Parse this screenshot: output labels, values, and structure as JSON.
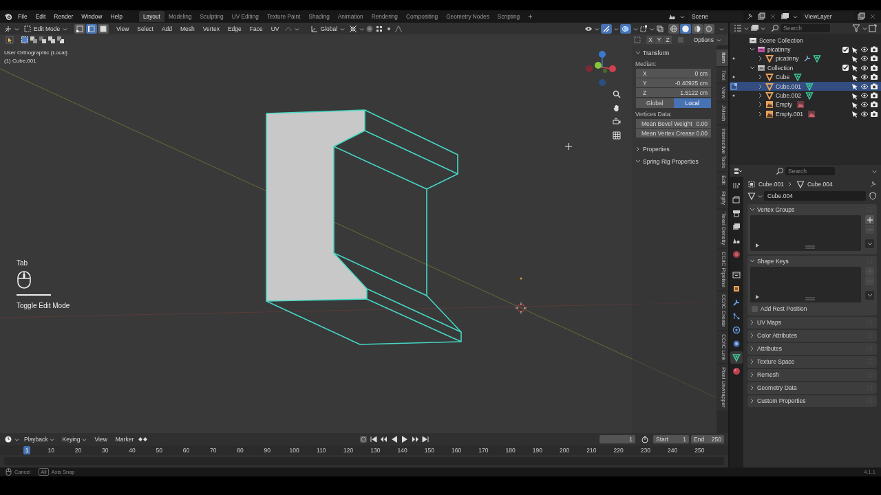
{
  "menu_bar": {
    "menus": [
      "File",
      "Edit",
      "Render",
      "Window",
      "Help"
    ],
    "workspaces": [
      {
        "label": "Layout",
        "selected": true
      },
      {
        "label": "Modeling",
        "selected": false
      },
      {
        "label": "Sculpting",
        "selected": false
      },
      {
        "label": "UV Editing",
        "selected": false
      },
      {
        "label": "Texture Paint",
        "selected": false
      },
      {
        "label": "Shading",
        "selected": false
      },
      {
        "label": "Animation",
        "selected": false
      },
      {
        "label": "Rendering",
        "selected": false
      },
      {
        "label": "Compositing",
        "selected": false
      },
      {
        "label": "Geometry Nodes",
        "selected": false
      },
      {
        "label": "Scripting",
        "selected": false
      }
    ],
    "add_workspace": "+",
    "scene": "Scene",
    "view_layer": "ViewLayer"
  },
  "viewport_header": {
    "mode": "Edit Mode",
    "select_modes": [
      {
        "kind": "vertex",
        "selected": false
      },
      {
        "kind": "edge",
        "selected": true
      },
      {
        "kind": "face",
        "selected": false
      }
    ],
    "menus": [
      "View",
      "Select",
      "Add",
      "Mesh",
      "Vertex",
      "Edge",
      "Face",
      "UV"
    ],
    "orientation": "Global",
    "shading": [
      {
        "kind": "wireframe",
        "selected": false
      },
      {
        "kind": "solid",
        "selected": true
      },
      {
        "kind": "material",
        "selected": false
      },
      {
        "kind": "rendered",
        "selected": false
      }
    ],
    "mirror_axes": [
      "X",
      "Y",
      "Z"
    ],
    "options": "Options"
  },
  "viewport": {
    "view_name": "User Orthographic (Local)",
    "object_name": "(1) Cube.001",
    "key_hint": {
      "key": "Tab",
      "action": "Toggle Edit Mode"
    }
  },
  "sidebar": {
    "section": "Transform",
    "median_label": "Median:",
    "fields": [
      {
        "label": "X",
        "value": "0 cm"
      },
      {
        "label": "Y",
        "value": "-0.40925 cm"
      },
      {
        "label": "Z",
        "value": "1.5122 cm"
      }
    ],
    "space": [
      {
        "label": "Global",
        "selected": false
      },
      {
        "label": "Local",
        "selected": true
      }
    ],
    "vertices_label": "Vertices Data:",
    "vertex_fields": [
      {
        "label": "Mean Bevel Weight",
        "value": "0.00"
      },
      {
        "label": "Mean Vertex Crease",
        "value": "0.00"
      }
    ],
    "panels": [
      {
        "label": "Properties",
        "expanded": false
      },
      {
        "label": "Spring Rig Properties",
        "expanded": true
      }
    ],
    "tabs": [
      {
        "label": "Item",
        "selected": true
      },
      {
        "label": "Tool",
        "selected": false
      },
      {
        "label": "View",
        "selected": false
      },
      {
        "label": "JMesh",
        "selected": false
      },
      {
        "label": "Interactive Tools",
        "selected": false
      },
      {
        "label": "Edit",
        "selected": false
      },
      {
        "label": "Rigify",
        "selected": false
      },
      {
        "label": "Texel Density",
        "selected": false
      },
      {
        "label": "CC/iC Pipeline",
        "selected": false
      },
      {
        "label": "CC/iC Create",
        "selected": false
      },
      {
        "label": "CC/iC Link",
        "selected": false
      },
      {
        "label": "Pixel Unwrapper",
        "selected": false
      }
    ]
  },
  "outliner": {
    "search_placeholder": "Search",
    "items": [
      {
        "label": "Scene Collection",
        "kind": "scene",
        "selected": false,
        "children": [
          {
            "label": "picatinny",
            "kind": "collection",
            "color": "#b84fa0",
            "expanded": true,
            "checked": true,
            "selected": false,
            "children": [
              {
                "label": "picatinny",
                "kind": "mesh",
                "expanded": false,
                "modifier": true,
                "selected": false
              }
            ]
          },
          {
            "label": "Collection",
            "kind": "collection",
            "color": "#9a9a9a",
            "expanded": true,
            "checked": true,
            "selected": false,
            "children": [
              {
                "label": "Cube",
                "kind": "mesh",
                "expanded": false,
                "modifier": false,
                "selected": false
              },
              {
                "label": "Cube.001",
                "kind": "mesh",
                "expanded": false,
                "modifier": false,
                "selected": true
              },
              {
                "label": "Cube.002",
                "kind": "mesh",
                "expanded": false,
                "modifier": false,
                "selected": false
              },
              {
                "label": "Empty",
                "kind": "empty",
                "expanded": false,
                "selected": false
              },
              {
                "label": "Empty.001",
                "kind": "empty",
                "expanded": false,
                "selected": false
              }
            ]
          }
        ]
      }
    ]
  },
  "properties": {
    "search_placeholder": "Search",
    "tabs": [
      {
        "kind": "tool",
        "selected": false
      },
      {
        "kind": "render",
        "selected": false
      },
      {
        "kind": "output",
        "selected": false
      },
      {
        "kind": "view_layer",
        "selected": false
      },
      {
        "kind": "scene",
        "selected": false
      },
      {
        "kind": "world",
        "selected": false
      },
      {
        "kind": "collection",
        "selected": false
      },
      {
        "kind": "object",
        "selected": false
      },
      {
        "kind": "modifiers",
        "selected": false
      },
      {
        "kind": "particles",
        "selected": false
      },
      {
        "kind": "physics",
        "selected": false
      },
      {
        "kind": "constraints",
        "selected": false
      },
      {
        "kind": "data",
        "selected": true
      },
      {
        "kind": "material",
        "selected": false
      }
    ],
    "breadcrumb": [
      "Cube.001",
      "Cube.004"
    ],
    "data_name": "Cube.004",
    "panels": [
      {
        "label": "Vertex Groups",
        "kind": "list",
        "expanded": true
      },
      {
        "label": "Shape Keys",
        "kind": "list",
        "expanded": true,
        "checkbox": {
          "label": "Add Rest Position",
          "checked": false
        }
      },
      {
        "label": "UV Maps",
        "kind": "plain",
        "expanded": false
      },
      {
        "label": "Color Attributes",
        "kind": "plain",
        "expanded": false
      },
      {
        "label": "Attributes",
        "kind": "plain",
        "expanded": false
      },
      {
        "label": "Texture Space",
        "kind": "plain",
        "expanded": false
      },
      {
        "label": "Remesh",
        "kind": "plain",
        "expanded": false
      },
      {
        "label": "Geometry Data",
        "kind": "plain",
        "expanded": false
      },
      {
        "label": "Custom Properties",
        "kind": "plain",
        "expanded": false
      }
    ]
  },
  "timeline": {
    "menus": [
      {
        "label": "Playback",
        "dropdown": true
      },
      {
        "label": "Keying",
        "dropdown": true
      },
      {
        "label": "View",
        "dropdown": false
      },
      {
        "label": "Marker",
        "dropdown": false
      }
    ],
    "current_frame": "1",
    "current_frame_badge": "1",
    "start_label": "Start",
    "start": "1",
    "end_label": "End",
    "end": "250",
    "ticks": [
      "10",
      "20",
      "30",
      "40",
      "50",
      "60",
      "70",
      "80",
      "90",
      "100",
      "110",
      "120",
      "130",
      "140",
      "150",
      "160",
      "170",
      "180",
      "190",
      "200",
      "210",
      "220",
      "230",
      "240",
      "250"
    ]
  },
  "status_bar": {
    "hints": [
      {
        "label": "Cancel"
      },
      {
        "key": "All",
        "label": "Axis Snap"
      }
    ],
    "version": "4.1.1"
  }
}
